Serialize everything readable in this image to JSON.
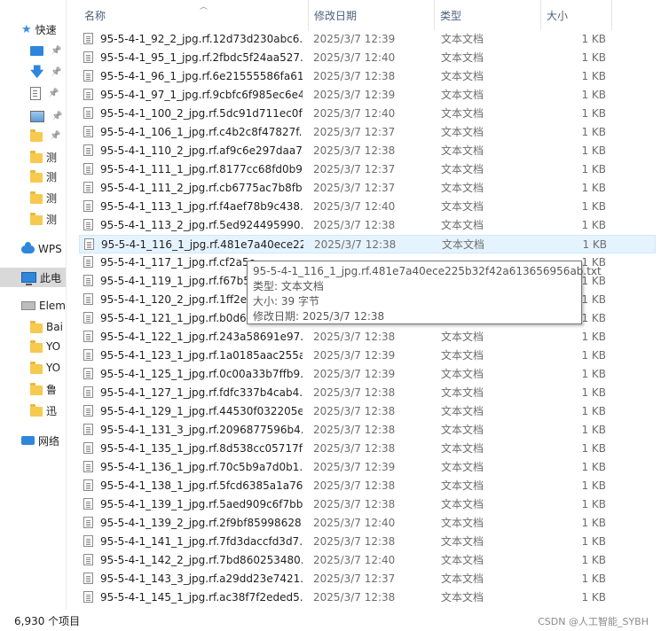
{
  "nav": {
    "items": [
      {
        "label": "快速",
        "icon": "star-icon",
        "kind": "group"
      },
      {
        "label": "",
        "icon": "desktop-icon",
        "kind": "pinned"
      },
      {
        "label": "",
        "icon": "download-icon",
        "kind": "pinned"
      },
      {
        "label": "",
        "icon": "document-icon",
        "kind": "pinned"
      },
      {
        "label": "",
        "icon": "picture-icon",
        "kind": "pinned"
      },
      {
        "label": "",
        "icon": "folder-icon",
        "kind": "pinned"
      },
      {
        "label": "测",
        "icon": "folder-icon",
        "kind": "folder"
      },
      {
        "label": "测",
        "icon": "folder-icon",
        "kind": "folder"
      },
      {
        "label": "测",
        "icon": "folder-icon",
        "kind": "folder"
      },
      {
        "label": "测",
        "icon": "folder-icon",
        "kind": "folder"
      },
      {
        "label": "WPS",
        "icon": "cloud-icon",
        "kind": "group"
      },
      {
        "label": "此电",
        "icon": "computer-icon",
        "kind": "group-selected"
      },
      {
        "label": "Elem",
        "icon": "drive-icon",
        "kind": "group"
      },
      {
        "label": "Bai",
        "icon": "folder-icon",
        "kind": "folder"
      },
      {
        "label": "YO",
        "icon": "folder-icon",
        "kind": "folder"
      },
      {
        "label": "YO",
        "icon": "folder-icon",
        "kind": "folder"
      },
      {
        "label": "鲁",
        "icon": "folder-icon",
        "kind": "folder"
      },
      {
        "label": "迅",
        "icon": "folder-icon",
        "kind": "folder"
      },
      {
        "label": "网络",
        "icon": "network-icon",
        "kind": "group"
      }
    ]
  },
  "header": {
    "name": "名称",
    "date": "修改日期",
    "type": "类型",
    "size": "大小"
  },
  "files": [
    {
      "name": "95-5-4-1_92_2_jpg.rf.12d73d230abc6...",
      "date": "2025/3/7 12:39",
      "type": "文本文档",
      "size": "1 KB"
    },
    {
      "name": "95-5-4-1_95_1_jpg.rf.2fbdc5f24aa527...",
      "date": "2025/3/7 12:40",
      "type": "文本文档",
      "size": "1 KB"
    },
    {
      "name": "95-5-4-1_96_1_jpg.rf.6e21555586fa61...",
      "date": "2025/3/7 12:38",
      "type": "文本文档",
      "size": "1 KB"
    },
    {
      "name": "95-5-4-1_97_1_jpg.rf.9cbfc6f985ec6e4...",
      "date": "2025/3/7 12:39",
      "type": "文本文档",
      "size": "1 KB"
    },
    {
      "name": "95-5-4-1_100_2_jpg.rf.5dc91d711ec0f...",
      "date": "2025/3/7 12:40",
      "type": "文本文档",
      "size": "1 KB"
    },
    {
      "name": "95-5-4-1_106_1_jpg.rf.c4b2c8f47827f...",
      "date": "2025/3/7 12:37",
      "type": "文本文档",
      "size": "1 KB"
    },
    {
      "name": "95-5-4-1_110_2_jpg.rf.af9c6e297daa7...",
      "date": "2025/3/7 12:38",
      "type": "文本文档",
      "size": "1 KB"
    },
    {
      "name": "95-5-4-1_111_1_jpg.rf.8177cc68fd0b9...",
      "date": "2025/3/7 12:37",
      "type": "文本文档",
      "size": "1 KB"
    },
    {
      "name": "95-5-4-1_111_2_jpg.rf.cb6775ac7b8fb...",
      "date": "2025/3/7 12:37",
      "type": "文本文档",
      "size": "1 KB"
    },
    {
      "name": "95-5-4-1_113_1_jpg.rf.f4aef78b9c438...",
      "date": "2025/3/7 12:40",
      "type": "文本文档",
      "size": "1 KB"
    },
    {
      "name": "95-5-4-1_113_2_jpg.rf.5ed924495990...",
      "date": "2025/3/7 12:38",
      "type": "文本文档",
      "size": "1 KB"
    },
    {
      "name": "95-5-4-1_116_1_jpg.rf.481e7a40ece22...",
      "date": "2025/3/7 12:38",
      "type": "文本文档",
      "size": "1 KB"
    },
    {
      "name": "95-5-4-1_117_1_jpg.rf.cf2a5e",
      "date": "",
      "type": "",
      "size": "1 KB"
    },
    {
      "name": "95-5-4-1_119_1_jpg.rf.f67b54",
      "date": "",
      "type": "",
      "size": "1 KB"
    },
    {
      "name": "95-5-4-1_120_2_jpg.rf.1ff2e4",
      "date": "",
      "type": "",
      "size": "1 KB"
    },
    {
      "name": "95-5-4-1_121_1_jpg.rf.b0d6b",
      "date": "",
      "type": "",
      "size": "1 KB"
    },
    {
      "name": "95-5-4-1_122_1_jpg.rf.243a58691e97...",
      "date": "2025/3/7 12:38",
      "type": "文本文档",
      "size": "1 KB"
    },
    {
      "name": "95-5-4-1_123_1_jpg.rf.1a0185aac255a...",
      "date": "2025/3/7 12:39",
      "type": "文本文档",
      "size": "1 KB"
    },
    {
      "name": "95-5-4-1_125_1_jpg.rf.0c00a33b7ffb9...",
      "date": "2025/3/7 12:39",
      "type": "文本文档",
      "size": "1 KB"
    },
    {
      "name": "95-5-4-1_127_1_jpg.rf.fdfc337b4cab4...",
      "date": "2025/3/7 12:38",
      "type": "文本文档",
      "size": "1 KB"
    },
    {
      "name": "95-5-4-1_129_1_jpg.rf.44530f032205e...",
      "date": "2025/3/7 12:38",
      "type": "文本文档",
      "size": "1 KB"
    },
    {
      "name": "95-5-4-1_131_3_jpg.rf.2096877596b4...",
      "date": "2025/3/7 12:38",
      "type": "文本文档",
      "size": "1 KB"
    },
    {
      "name": "95-5-4-1_135_1_jpg.rf.8d538cc05717f...",
      "date": "2025/3/7 12:38",
      "type": "文本文档",
      "size": "1 KB"
    },
    {
      "name": "95-5-4-1_136_1_jpg.rf.70c5b9a7d0b1...",
      "date": "2025/3/7 12:39",
      "type": "文本文档",
      "size": "1 KB"
    },
    {
      "name": "95-5-4-1_138_1_jpg.rf.5fcd6385a1a76...",
      "date": "2025/3/7 12:38",
      "type": "文本文档",
      "size": "1 KB"
    },
    {
      "name": "95-5-4-1_139_1_jpg.rf.5aed909c6f7bb...",
      "date": "2025/3/7 12:38",
      "type": "文本文档",
      "size": "1 KB"
    },
    {
      "name": "95-5-4-1_139_2_jpg.rf.2f9bf85998628...",
      "date": "2025/3/7 12:40",
      "type": "文本文档",
      "size": "1 KB"
    },
    {
      "name": "95-5-4-1_141_1_jpg.rf.7fd3daccfd3d7...",
      "date": "2025/3/7 12:38",
      "type": "文本文档",
      "size": "1 KB"
    },
    {
      "name": "95-5-4-1_142_2_jpg.rf.7bd860253480...",
      "date": "2025/3/7 12:40",
      "type": "文本文档",
      "size": "1 KB"
    },
    {
      "name": "95-5-4-1_143_3_jpg.rf.a29dd23e7421...",
      "date": "2025/3/7 12:37",
      "type": "文本文档",
      "size": "1 KB"
    },
    {
      "name": "95-5-4-1_145_1_jpg.rf.ac38f7f2eded5...",
      "date": "2025/3/7 12:38",
      "type": "文本文档",
      "size": "1 KB"
    }
  ],
  "hovered_row": 11,
  "tooltip": {
    "filename": "95-5-4-1_116_1_jpg.rf.481e7a40ece225b32f42a613656956ab.txt",
    "type_line": "类型: 文本文档",
    "size_line": "大小: 39 字节",
    "date_line": "修改日期: 2025/3/7 12:38"
  },
  "status": {
    "item_count": "6,930 个项目",
    "watermark": "CSDN @人工智能_SYBH"
  },
  "colors": {
    "hover_bg": "#e5f3ff",
    "hover_border": "#cce8ff",
    "header_text": "#4c607a",
    "accent": "#2f86dd"
  }
}
